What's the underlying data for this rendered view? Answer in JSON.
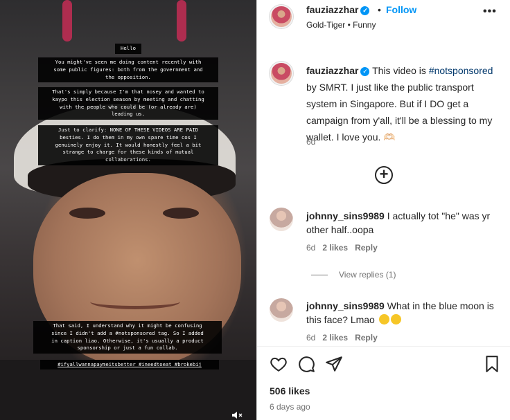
{
  "story": {
    "boxes": [
      "Hello",
      "You might've seen me doing content recently with\nsome public figures: both from the government and\nthe opposition.",
      "That's simply because I'm that nosey and wanted to\nkaypo this election season by meeting and chatting\nwith the people who could be (or already are)\nleading us.",
      "Just to clarify: NONE OF THESE VIDEOS ARE PAID\nbesties. I do them in my own spare time cos I\ngenuinely enjoy it. It would honestly feel a bit\nstrange to charge for these kinds of mutual\ncollaborations.",
      "That said, I understand why it might be confusing\nsince I didn't add a #notsponsored tag. So I added\nin caption liao. Otherwise, it's usually a product\nsponsorship or just a fun collab."
    ],
    "tags": "#ifyallwannapaymeitsbetter #ineedtoeat #brokebij"
  },
  "header": {
    "username": "fauziazzhar",
    "follow_label": "Follow",
    "subline": "Gold-Tiger • Funny"
  },
  "caption": {
    "username": "fauziazzhar",
    "before_tag": "This video is ",
    "hashtag": "#notsponsored",
    "after_tag": " by SMRT. I just like the public transport system in Singapore. But if I DO get a campaign from y'all, it'll be a blessing to my wallet. I love you. 🫶🏻",
    "age": "6d"
  },
  "comments": [
    {
      "username": "johnny_sins9989",
      "text": "I actually tot \"he\" was yr other half..oopa",
      "age": "6d",
      "likes": "2 likes",
      "reply": "Reply"
    },
    {
      "username": "johnny_sins9989",
      "text": "What in the blue moon is this face? Lmao",
      "age": "6d",
      "likes": "2 likes",
      "reply": "Reply"
    }
  ],
  "view_replies": "View replies (1)",
  "footer": {
    "likes": "506 likes",
    "time": "6 days ago"
  }
}
